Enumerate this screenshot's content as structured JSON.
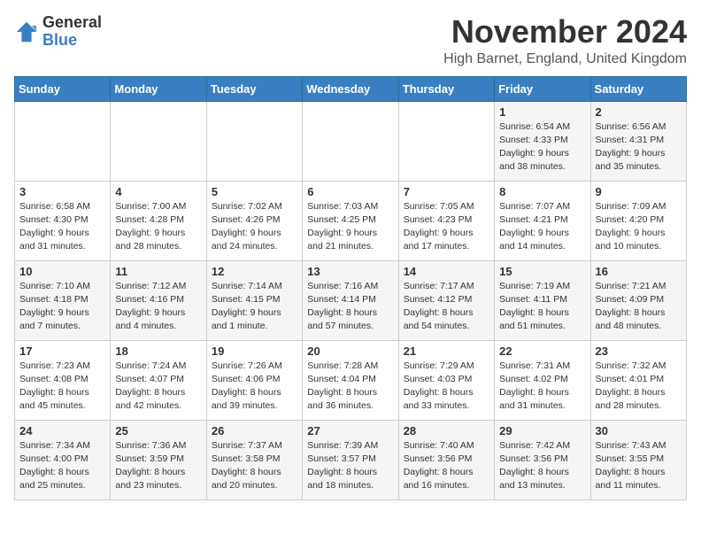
{
  "logo": {
    "general": "General",
    "blue": "Blue"
  },
  "header": {
    "month": "November 2024",
    "location": "High Barnet, England, United Kingdom"
  },
  "days_of_week": [
    "Sunday",
    "Monday",
    "Tuesday",
    "Wednesday",
    "Thursday",
    "Friday",
    "Saturday"
  ],
  "weeks": [
    [
      {
        "day": "",
        "info": ""
      },
      {
        "day": "",
        "info": ""
      },
      {
        "day": "",
        "info": ""
      },
      {
        "day": "",
        "info": ""
      },
      {
        "day": "",
        "info": ""
      },
      {
        "day": "1",
        "info": "Sunrise: 6:54 AM\nSunset: 4:33 PM\nDaylight: 9 hours\nand 38 minutes."
      },
      {
        "day": "2",
        "info": "Sunrise: 6:56 AM\nSunset: 4:31 PM\nDaylight: 9 hours\nand 35 minutes."
      }
    ],
    [
      {
        "day": "3",
        "info": "Sunrise: 6:58 AM\nSunset: 4:30 PM\nDaylight: 9 hours\nand 31 minutes."
      },
      {
        "day": "4",
        "info": "Sunrise: 7:00 AM\nSunset: 4:28 PM\nDaylight: 9 hours\nand 28 minutes."
      },
      {
        "day": "5",
        "info": "Sunrise: 7:02 AM\nSunset: 4:26 PM\nDaylight: 9 hours\nand 24 minutes."
      },
      {
        "day": "6",
        "info": "Sunrise: 7:03 AM\nSunset: 4:25 PM\nDaylight: 9 hours\nand 21 minutes."
      },
      {
        "day": "7",
        "info": "Sunrise: 7:05 AM\nSunset: 4:23 PM\nDaylight: 9 hours\nand 17 minutes."
      },
      {
        "day": "8",
        "info": "Sunrise: 7:07 AM\nSunset: 4:21 PM\nDaylight: 9 hours\nand 14 minutes."
      },
      {
        "day": "9",
        "info": "Sunrise: 7:09 AM\nSunset: 4:20 PM\nDaylight: 9 hours\nand 10 minutes."
      }
    ],
    [
      {
        "day": "10",
        "info": "Sunrise: 7:10 AM\nSunset: 4:18 PM\nDaylight: 9 hours\nand 7 minutes."
      },
      {
        "day": "11",
        "info": "Sunrise: 7:12 AM\nSunset: 4:16 PM\nDaylight: 9 hours\nand 4 minutes."
      },
      {
        "day": "12",
        "info": "Sunrise: 7:14 AM\nSunset: 4:15 PM\nDaylight: 9 hours\nand 1 minute."
      },
      {
        "day": "13",
        "info": "Sunrise: 7:16 AM\nSunset: 4:14 PM\nDaylight: 8 hours\nand 57 minutes."
      },
      {
        "day": "14",
        "info": "Sunrise: 7:17 AM\nSunset: 4:12 PM\nDaylight: 8 hours\nand 54 minutes."
      },
      {
        "day": "15",
        "info": "Sunrise: 7:19 AM\nSunset: 4:11 PM\nDaylight: 8 hours\nand 51 minutes."
      },
      {
        "day": "16",
        "info": "Sunrise: 7:21 AM\nSunset: 4:09 PM\nDaylight: 8 hours\nand 48 minutes."
      }
    ],
    [
      {
        "day": "17",
        "info": "Sunrise: 7:23 AM\nSunset: 4:08 PM\nDaylight: 8 hours\nand 45 minutes."
      },
      {
        "day": "18",
        "info": "Sunrise: 7:24 AM\nSunset: 4:07 PM\nDaylight: 8 hours\nand 42 minutes."
      },
      {
        "day": "19",
        "info": "Sunrise: 7:26 AM\nSunset: 4:06 PM\nDaylight: 8 hours\nand 39 minutes."
      },
      {
        "day": "20",
        "info": "Sunrise: 7:28 AM\nSunset: 4:04 PM\nDaylight: 8 hours\nand 36 minutes."
      },
      {
        "day": "21",
        "info": "Sunrise: 7:29 AM\nSunset: 4:03 PM\nDaylight: 8 hours\nand 33 minutes."
      },
      {
        "day": "22",
        "info": "Sunrise: 7:31 AM\nSunset: 4:02 PM\nDaylight: 8 hours\nand 31 minutes."
      },
      {
        "day": "23",
        "info": "Sunrise: 7:32 AM\nSunset: 4:01 PM\nDaylight: 8 hours\nand 28 minutes."
      }
    ],
    [
      {
        "day": "24",
        "info": "Sunrise: 7:34 AM\nSunset: 4:00 PM\nDaylight: 8 hours\nand 25 minutes."
      },
      {
        "day": "25",
        "info": "Sunrise: 7:36 AM\nSunset: 3:59 PM\nDaylight: 8 hours\nand 23 minutes."
      },
      {
        "day": "26",
        "info": "Sunrise: 7:37 AM\nSunset: 3:58 PM\nDaylight: 8 hours\nand 20 minutes."
      },
      {
        "day": "27",
        "info": "Sunrise: 7:39 AM\nSunset: 3:57 PM\nDaylight: 8 hours\nand 18 minutes."
      },
      {
        "day": "28",
        "info": "Sunrise: 7:40 AM\nSunset: 3:56 PM\nDaylight: 8 hours\nand 16 minutes."
      },
      {
        "day": "29",
        "info": "Sunrise: 7:42 AM\nSunset: 3:56 PM\nDaylight: 8 hours\nand 13 minutes."
      },
      {
        "day": "30",
        "info": "Sunrise: 7:43 AM\nSunset: 3:55 PM\nDaylight: 8 hours\nand 11 minutes."
      }
    ]
  ]
}
